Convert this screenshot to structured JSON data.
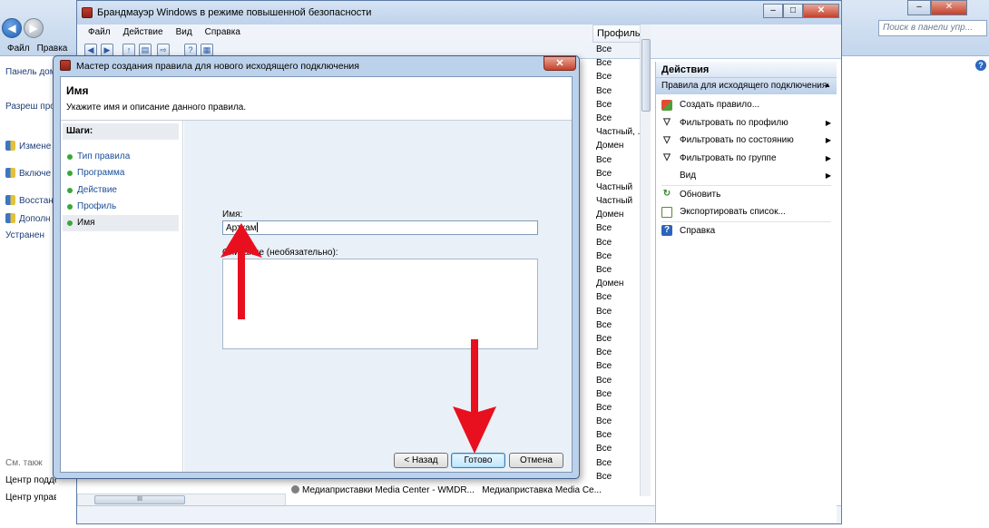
{
  "control_panel": {
    "search_placeholder": "Поиск в панели упр...",
    "menu": [
      "Файл",
      "Правка"
    ],
    "sidebar": {
      "link1": "Панель домашн",
      "link2": "Разреш програм через бр",
      "items": [
        "Измене уведомл",
        "Включе брандма",
        "Восстан",
        "Дополн"
      ],
      "link3": "Устранен",
      "see_also": "См. такж",
      "bottom1": "Центр подде",
      "bottom2": "Центр управ общим досту"
    }
  },
  "firewall": {
    "title": "Брандмауэр Windows в режиме повышенной безопасности",
    "menu": [
      "Файл",
      "Действие",
      "Вид",
      "Справка"
    ],
    "column_header": "Профиль",
    "profiles": [
      "Все",
      "Все",
      "Все",
      "Все",
      "Все",
      "Все",
      "Частный, .",
      "Домен",
      "Все",
      "Все",
      "Частный",
      "Частный",
      "Домен",
      "Все",
      "Все",
      "Все",
      "Все",
      "Домен",
      "Все",
      "Все",
      "Все",
      "Все",
      "Все",
      "Все",
      "Все",
      "Все",
      "Все",
      "Все",
      "Все",
      "Все",
      "Все",
      "Все"
    ],
    "bottom_row": {
      "name": "Медиаприставки Media Center - WMDR...",
      "group": "Медиаприставка Media Ce..."
    },
    "actions": {
      "header": "Действия",
      "section": "Правила для исходящего подключения",
      "items": [
        {
          "label": "Создать правило...",
          "icon": "new-rule-icon"
        },
        {
          "label": "Фильтровать по профилю",
          "icon": "filter-icon"
        },
        {
          "label": "Фильтровать по состоянию",
          "icon": "filter-icon"
        },
        {
          "label": "Фильтровать по группе",
          "icon": "filter-icon"
        },
        {
          "label": "Вид",
          "icon": ""
        },
        {
          "label": "Обновить",
          "icon": "refresh-icon"
        },
        {
          "label": "Экспортировать список...",
          "icon": "export-icon"
        },
        {
          "label": "Справка",
          "icon": "help-icon"
        }
      ]
    }
  },
  "wizard": {
    "title": "Мастер создания правила для нового исходящего подключения",
    "heading": "Имя",
    "subheading": "Укажите имя и описание данного правила.",
    "steps_header": "Шаги:",
    "steps": [
      "Тип правила",
      "Программа",
      "Действие",
      "Профиль",
      "Имя"
    ],
    "active_step": 4,
    "name_label": "Имя:",
    "name_value": "Арткам",
    "desc_label": "Описание (необязательно):",
    "buttons": {
      "back": "< Назад",
      "finish": "Готово",
      "cancel": "Отмена"
    }
  },
  "colors": {
    "accent_arrow": "#e8101e",
    "step_dot": "#3aa63a"
  }
}
